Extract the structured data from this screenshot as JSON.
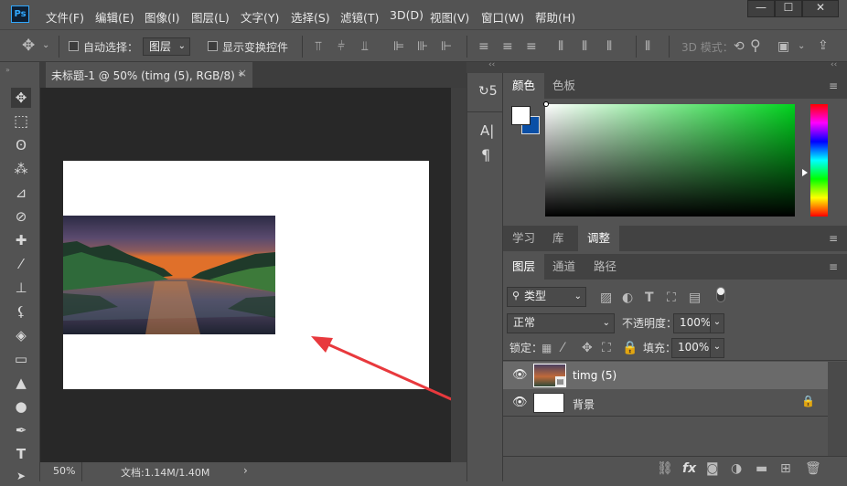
{
  "app": {
    "logo": "Ps"
  },
  "menu": [
    "文件(F)",
    "编辑(E)",
    "图像(I)",
    "图层(L)",
    "文字(Y)",
    "选择(S)",
    "滤镜(T)",
    "3D(D)",
    "视图(V)",
    "窗口(W)",
    "帮助(H)"
  ],
  "window_controls": [
    "—",
    "☐",
    "✕"
  ],
  "options": {
    "auto_select_label": "自动选择：",
    "auto_select_target": "图层",
    "show_transform_label": "显示变换控件",
    "mode_3d_label": "3D 模式："
  },
  "document": {
    "tab_title": "未标题-1 @ 50% (timg (5), RGB/8) *",
    "tab_close": "×"
  },
  "status": {
    "zoom": "50%",
    "doc_size": "文档:1.14M/1.40M",
    "arrow": "›"
  },
  "collapsed_panel": {
    "history_label": "↻5",
    "char_label": "A|",
    "para_label": "¶"
  },
  "color_panel": {
    "tabs": [
      "颜色",
      "色板"
    ],
    "active": "颜色",
    "menu_icon": "≡"
  },
  "learn_panel": {
    "tabs": [
      "学习",
      "库",
      "调整"
    ],
    "active": "调整"
  },
  "layers_panel": {
    "tabs": [
      "图层",
      "通道",
      "路径"
    ],
    "active": "图层",
    "filter_kind": "类型",
    "blend_mode": "正常",
    "opacity_label": "不透明度：",
    "opacity_value": "100%",
    "lock_label": "锁定：",
    "fill_label": "填充：",
    "fill_value": "100%",
    "layers": [
      {
        "name": "timg (5)",
        "visible": true,
        "selected": true
      },
      {
        "name": "背景",
        "visible": true,
        "locked": true
      }
    ],
    "footer_icons": [
      "link-icon",
      "fx-icon",
      "mask-icon",
      "adjustment-icon",
      "group-icon",
      "new-layer-icon",
      "trash-icon"
    ],
    "fx_label": "fx"
  },
  "colors": {
    "accent": "#31a8ff",
    "arrow": "#e8393d",
    "bg_swatch": "#0a4fa6",
    "fg_swatch": "#ffffff",
    "selected_layer": "#6a6a6a"
  }
}
